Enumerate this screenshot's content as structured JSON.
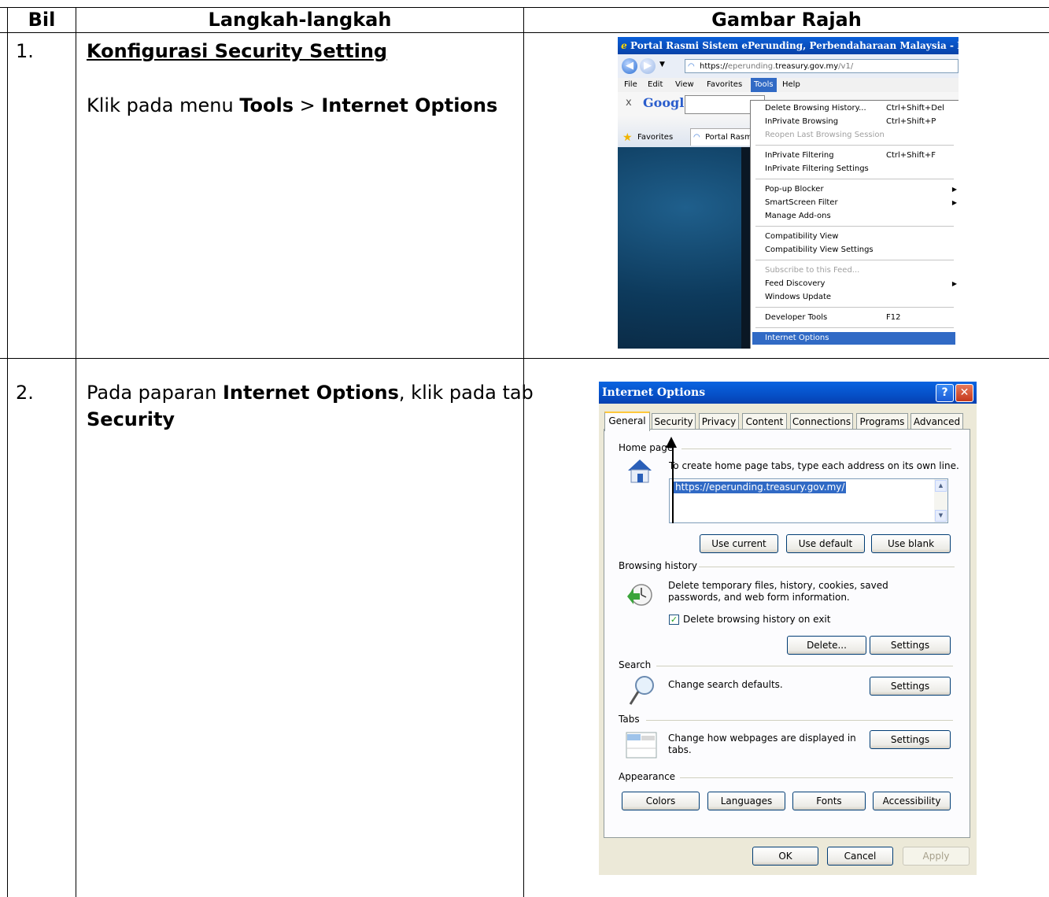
{
  "table": {
    "headers": [
      "Bil",
      "Langkah-langkah",
      "Gambar Rajah"
    ],
    "rows": [
      {
        "num": "1.",
        "title": "Konfigurasi Security Setting",
        "step_prefix": "Klik pada menu ",
        "step_b1": "Tools",
        "step_mid": " > ",
        "step_b2": "Internet Options"
      },
      {
        "num": "2.",
        "step_prefix": "Pada paparan ",
        "step_b1": "Internet Options",
        "step_mid": ", klik pada tab",
        "step_b2": "Security"
      }
    ]
  },
  "browser": {
    "title": "Portal Rasmi Sistem ePerunding, Perbendaharaan Malaysia - Intern",
    "url_scheme": "https://",
    "url_host_pre": "eperunding.",
    "url_host": "treasury.gov.my",
    "url_path": "/v1/",
    "menubar": [
      "File",
      "Edit",
      "View",
      "Favorites",
      "Tools",
      "Help"
    ],
    "google_close": "x",
    "google_label": "Google",
    "favorites_label": "Favorites",
    "tab_label": "Portal Rasmi",
    "tools_menu": [
      {
        "label": "Delete Browsing History...",
        "shortcut": "Ctrl+Shift+Del"
      },
      {
        "label": "InPrivate Browsing",
        "shortcut": "Ctrl+Shift+P"
      },
      {
        "label": "Reopen Last Browsing Session",
        "shortcut": "",
        "disabled": true
      },
      {
        "label": "InPrivate Filtering",
        "shortcut": "Ctrl+Shift+F"
      },
      {
        "label": "InPrivate Filtering Settings",
        "shortcut": ""
      },
      {
        "label": "Pop-up Blocker",
        "shortcut": ""
      },
      {
        "label": "SmartScreen Filter",
        "shortcut": ""
      },
      {
        "label": "Manage Add-ons",
        "shortcut": ""
      },
      {
        "label": "Compatibility View",
        "shortcut": ""
      },
      {
        "label": "Compatibility View Settings",
        "shortcut": ""
      },
      {
        "label": "Subscribe to this Feed...",
        "shortcut": "",
        "disabled": true
      },
      {
        "label": "Feed Discovery",
        "shortcut": ""
      },
      {
        "label": "Windows Update",
        "shortcut": ""
      },
      {
        "label": "Developer Tools",
        "shortcut": "F12"
      },
      {
        "label": "Internet Options",
        "shortcut": "",
        "selected": true
      }
    ]
  },
  "dialog": {
    "title": "Internet Options",
    "help_glyph": "?",
    "close_glyph": "✕",
    "tabs": [
      "General",
      "Security",
      "Privacy",
      "Content",
      "Connections",
      "Programs",
      "Advanced"
    ],
    "home_page_label": "Home page",
    "home_page_text": "To create home page tabs, type each address on its own line.",
    "home_url": "https://eperunding.treasury.gov.my/",
    "btn_use_current": "Use current",
    "btn_use_default": "Use default",
    "btn_use_blank": "Use blank",
    "history_label": "Browsing history",
    "history_text": "Delete temporary files, history, cookies, saved passwords, and web form information.",
    "history_checkbox": "Delete browsing history on exit",
    "btn_delete": "Delete...",
    "btn_settings": "Settings",
    "search_label": "Search",
    "search_text": "Change search defaults.",
    "tabs_label": "Tabs",
    "tabs_text": "Change how webpages are displayed in tabs.",
    "appearance_label": "Appearance",
    "btn_colors": "Colors",
    "btn_languages": "Languages",
    "btn_fonts": "Fonts",
    "btn_accessibility": "Accessibility",
    "btn_ok": "OK",
    "btn_cancel": "Cancel",
    "btn_apply": "Apply"
  }
}
